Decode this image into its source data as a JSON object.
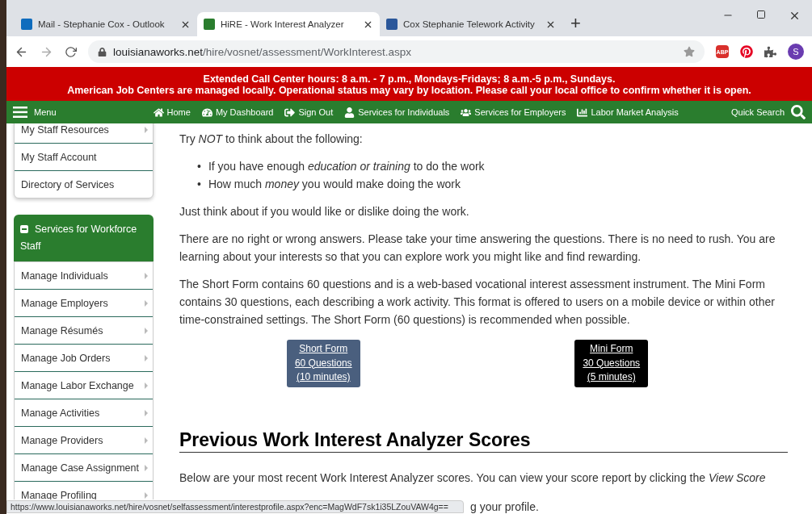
{
  "browser": {
    "tabs": [
      {
        "title": "Mail - Stephanie Cox - Outlook",
        "selected": false,
        "kind": "outlook"
      },
      {
        "title": "HiRE - Work Interest Analyzer",
        "selected": true,
        "kind": "hire"
      },
      {
        "title": "Cox Stephanie Telework Activity",
        "selected": false,
        "kind": "word"
      }
    ],
    "new_tab": "+",
    "url_host": "louisianaworks.net",
    "url_path": "/hire/vosnet/assessment/WorkInterest.aspx",
    "adblock_label": "ABP",
    "profile_initial": "S"
  },
  "banner": [
    "Extended Call Center hours: 8 a.m. - 7 p.m., Mondays-Fridays; 8 a.m.-5 p.m., Sundays.",
    "American Job Centers are managed locally. Operational status may vary by location. Please call your local office to confirm whether it is open."
  ],
  "nav": {
    "menu": "Menu",
    "links": [
      {
        "label": "Home"
      },
      {
        "label": "My Dashboard"
      },
      {
        "label": "Sign Out"
      },
      {
        "label": "Services for Individuals"
      },
      {
        "label": "Services for Employers"
      },
      {
        "label": "Labor Market Analysis"
      }
    ],
    "quick_search": "Quick Search"
  },
  "sidebar": {
    "top_items": [
      {
        "label": "My Staff Resources",
        "has_submenu": true
      },
      {
        "label": "My Staff Account",
        "has_submenu": false
      },
      {
        "label": "Directory of Services",
        "has_submenu": false
      }
    ],
    "section": {
      "title": "Services for Workforce Staff",
      "expanded": true,
      "items": [
        {
          "label": "Manage Individuals",
          "has_submenu": true
        },
        {
          "label": "Manage Employers",
          "has_submenu": true
        },
        {
          "label": "Manage Résumés",
          "has_submenu": true
        },
        {
          "label": "Manage Job Orders",
          "has_submenu": true
        },
        {
          "label": "Manage Labor Exchange",
          "has_submenu": true
        },
        {
          "label": "Manage Activities",
          "has_submenu": true
        },
        {
          "label": "Manage Providers",
          "has_submenu": true
        },
        {
          "label": "Manage Case Assignment",
          "has_submenu": true
        },
        {
          "label": "Manage Profiling",
          "has_submenu": true
        }
      ]
    }
  },
  "content": {
    "intro": "Try *NOT* to think about the following:",
    "bullets": [
      {
        "marker": "•",
        "text": "If you have enough *education or training* to do the work"
      },
      {
        "marker": "•",
        "text": "How much *money* you would make doing the work"
      }
    ],
    "paragraphs": [
      "Just think about if you would like or dislike doing the work.",
      "There are no right or wrong answers. Please take your time answering the questions. There is no need to rush. You are learning about your interests so that you can explore work you might like and find rewarding.",
      "The Short Form contains 60 questions and is a web-based vocational interest assessment instrument. The Mini Form contains 30 questions, each describing a work activity. This format is offered to users on a mobile device or within other time-constrained settings. The Short Form (60 questions) is recommended when possible."
    ],
    "forms": [
      {
        "lines": [
          "Short Form",
          "60 Questions",
          "(10 minutes)"
        ],
        "color": "#4a5f7e"
      },
      {
        "lines": [
          "Mini Form",
          "30 Questions",
          "(5 minutes)"
        ],
        "color": "#000000"
      }
    ],
    "heading": "Previous Work Interest Analyzer Scores",
    "scores_text": "Below are your most recent Work Interest Analyzer scores. You can view your score report by clicking the *View Score*",
    "scores_text_tail": "g your profile."
  },
  "status_url": "https://www.louisianaworks.net/hire/vosnet/selfassessment/interestprofile.aspx?enc=MagWdF7sk1i35LZouVAW4g=="
}
